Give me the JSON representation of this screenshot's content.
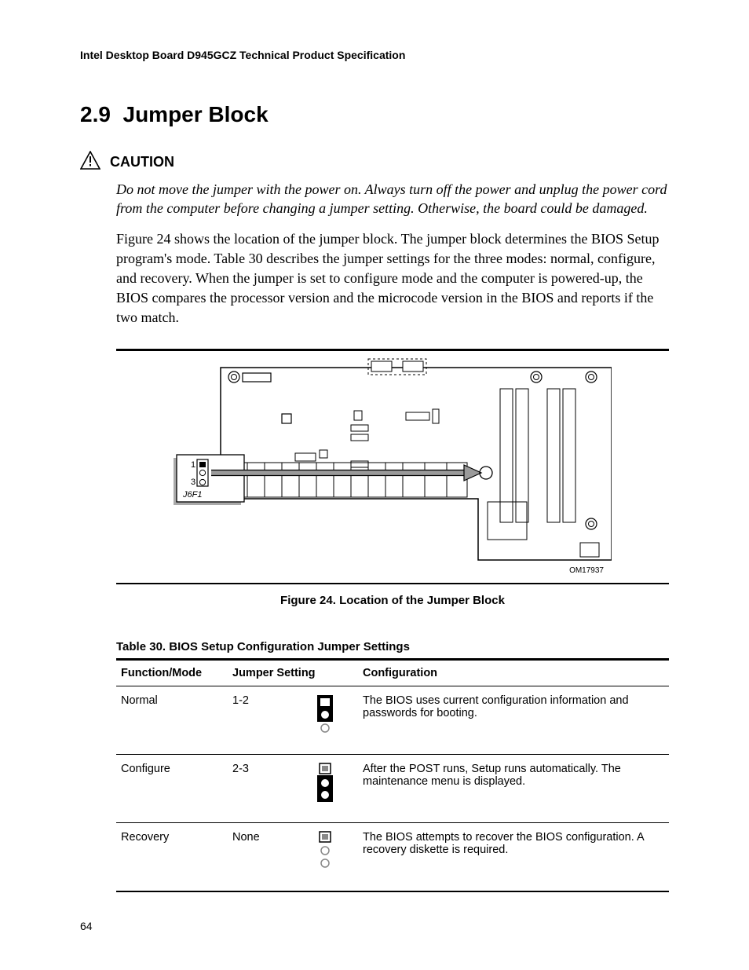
{
  "header": {
    "running": "Intel Desktop Board D945GCZ Technical Product Specification"
  },
  "section": {
    "number": "2.9",
    "title": "Jumper Block"
  },
  "caution": {
    "label": "CAUTION",
    "text": "Do not move the jumper with the power on.  Always turn off the power and unplug the power cord from the computer before changing a jumper setting.  Otherwise, the board could be damaged."
  },
  "body": {
    "paragraph": "Figure 24 shows the location of the jumper block.  The jumper block determines the BIOS Setup program's mode.  Table 30 describes the jumper settings for the three modes:  normal, configure, and recovery.  When the jumper is set to configure mode and the computer is powered-up, the BIOS compares the processor version and the microcode version in the BIOS and reports if the two match."
  },
  "figure": {
    "jumper_pin_top": "1",
    "jumper_pin_bottom": "3",
    "jumper_ref": "J6F1",
    "om_number": "OM17937",
    "caption": "Figure 24.  Location of the Jumper Block"
  },
  "table": {
    "caption": "Table 30.    BIOS Setup Configuration Jumper Settings",
    "headers": {
      "function": "Function/Mode",
      "setting": "Jumper Setting",
      "config": "Configuration"
    },
    "rows": [
      {
        "function": "Normal",
        "setting": "1-2",
        "icon": "j12",
        "config": "The BIOS uses current configuration information and passwords for booting."
      },
      {
        "function": "Configure",
        "setting": "2-3",
        "icon": "j23",
        "config": "After the POST runs, Setup runs automatically.  The maintenance menu is displayed."
      },
      {
        "function": "Recovery",
        "setting": "None",
        "icon": "jnone",
        "config": "The BIOS attempts to recover the BIOS configuration.  A recovery diskette is required."
      }
    ]
  },
  "page_number": "64"
}
